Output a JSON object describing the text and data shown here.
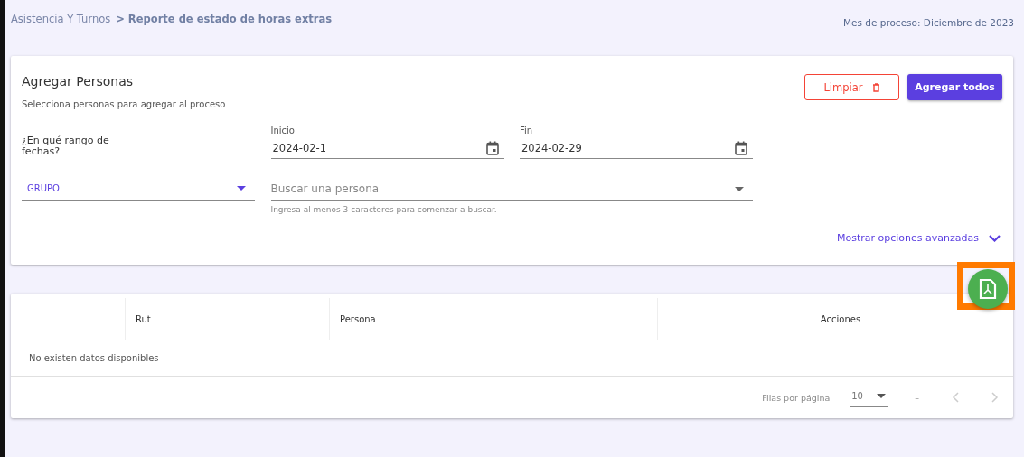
{
  "breadcrumb": [
    {
      "label": "Asistencia Y Turnos",
      "current": false
    },
    {
      "label": "> Reporte de estado de horas extras",
      "current": true
    }
  ],
  "process_month": "Mes de proceso: Diciembre de 2023",
  "add_card": {
    "title": "Agregar Personas",
    "subtitle": "Selecciona personas para agregar al proceso",
    "buttons": [
      {
        "label": "Limpiar",
        "kind": "outlined"
      },
      {
        "label": "Agregar todos",
        "kind": "filled"
      }
    ],
    "date_range_label": "¿En qué rango de fechas?",
    "date_fields": [
      {
        "label": "Inicio",
        "value": "2024-02-1"
      },
      {
        "label": "Fin",
        "value": "2024-02-29"
      }
    ],
    "group_select": {
      "label": "GRUPO"
    },
    "person_search": {
      "placeholder": "Buscar una persona",
      "hint": "Ingresa al menos 3 caracteres para comenzar a buscar."
    },
    "advanced_toggle": {
      "label": "Mostrar opciones avanzadas",
      "expanded": false
    }
  },
  "table": {
    "columns": [
      "Rut",
      "Persona",
      "Acciones"
    ],
    "empty_message": "No existen datos disponibles",
    "footer": {
      "rows_per_page_label": "Filas por página",
      "rows_per_page_value": "10",
      "range": "–"
    }
  },
  "pdf_button": {
    "highlighted": true
  }
}
